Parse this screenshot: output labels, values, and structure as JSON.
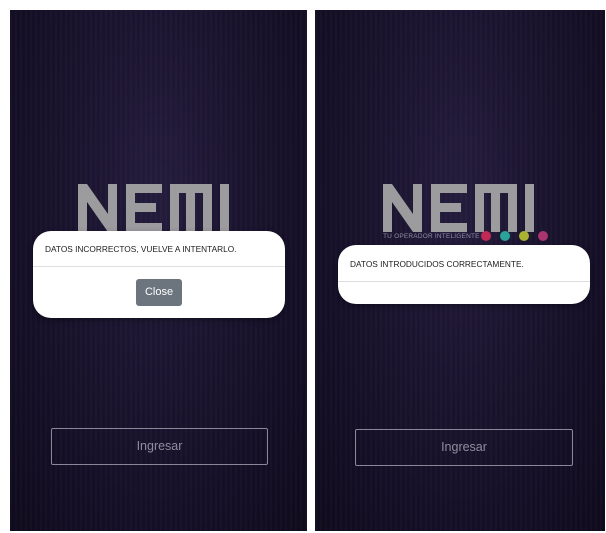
{
  "screens": [
    {
      "logo_text": "NEMI",
      "dialog": {
        "message": "DATOS INCORRECTOS, VUELVE A INTENTARLO.",
        "close_label": "Close"
      },
      "ingresar_label": "Ingresar"
    },
    {
      "logo_text": "NEMI",
      "tagline": "TU OPERADOR INTELIGENTE",
      "dot_colors": [
        "#c02a55",
        "#2aa39a",
        "#a9b331",
        "#a8356e"
      ],
      "dialog": {
        "message": "DATOS INTRODUCIDOS CORRECTAMENTE."
      },
      "ingresar_label": "Ingresar"
    }
  ],
  "colors": {
    "logo": "#9c9c9f",
    "background": "#17112a",
    "close_button": "#6c757d"
  }
}
